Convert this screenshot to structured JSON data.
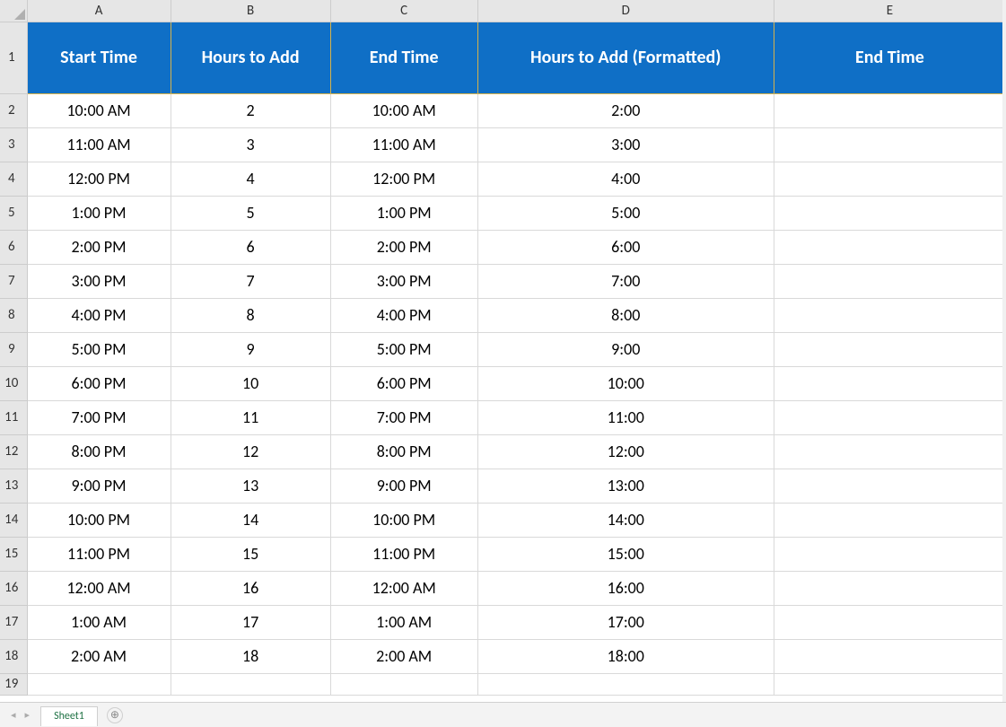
{
  "columnHeaders": [
    "A",
    "B",
    "C",
    "D",
    "E"
  ],
  "rowHeaders": [
    "1",
    "2",
    "3",
    "4",
    "5",
    "6",
    "7",
    "8",
    "9",
    "10",
    "11",
    "12",
    "13",
    "14",
    "15",
    "16",
    "17",
    "18",
    "19"
  ],
  "headerRow": {
    "A": "Start Time",
    "B": "Hours to Add",
    "C": "End Time",
    "D": "Hours to Add (Formatted)",
    "E": "End Time"
  },
  "rows": [
    {
      "A": "10:00 AM",
      "B": "2",
      "C": "10:00 AM",
      "D": "2:00",
      "E": ""
    },
    {
      "A": "11:00 AM",
      "B": "3",
      "C": "11:00 AM",
      "D": "3:00",
      "E": ""
    },
    {
      "A": "12:00 PM",
      "B": "4",
      "C": "12:00 PM",
      "D": "4:00",
      "E": ""
    },
    {
      "A": "1:00 PM",
      "B": "5",
      "C": "1:00 PM",
      "D": "5:00",
      "E": ""
    },
    {
      "A": "2:00 PM",
      "B": "6",
      "C": "2:00 PM",
      "D": "6:00",
      "E": ""
    },
    {
      "A": "3:00 PM",
      "B": "7",
      "C": "3:00 PM",
      "D": "7:00",
      "E": ""
    },
    {
      "A": "4:00 PM",
      "B": "8",
      "C": "4:00 PM",
      "D": "8:00",
      "E": ""
    },
    {
      "A": "5:00 PM",
      "B": "9",
      "C": "5:00 PM",
      "D": "9:00",
      "E": ""
    },
    {
      "A": "6:00 PM",
      "B": "10",
      "C": "6:00 PM",
      "D": "10:00",
      "E": ""
    },
    {
      "A": "7:00 PM",
      "B": "11",
      "C": "7:00 PM",
      "D": "11:00",
      "E": ""
    },
    {
      "A": "8:00 PM",
      "B": "12",
      "C": "8:00 PM",
      "D": "12:00",
      "E": ""
    },
    {
      "A": "9:00 PM",
      "B": "13",
      "C": "9:00 PM",
      "D": "13:00",
      "E": ""
    },
    {
      "A": "10:00 PM",
      "B": "14",
      "C": "10:00 PM",
      "D": "14:00",
      "E": ""
    },
    {
      "A": "11:00 PM",
      "B": "15",
      "C": "11:00 PM",
      "D": "15:00",
      "E": ""
    },
    {
      "A": "12:00 AM",
      "B": "16",
      "C": "12:00 AM",
      "D": "16:00",
      "E": ""
    },
    {
      "A": "1:00 AM",
      "B": "17",
      "C": "1:00 AM",
      "D": "17:00",
      "E": ""
    },
    {
      "A": "2:00 AM",
      "B": "18",
      "C": "2:00 AM",
      "D": "18:00",
      "E": ""
    }
  ],
  "tabs": {
    "active": "Sheet1"
  },
  "icons": {
    "newTab": "⊕",
    "navPrev": "◂",
    "navNext": "▸"
  }
}
